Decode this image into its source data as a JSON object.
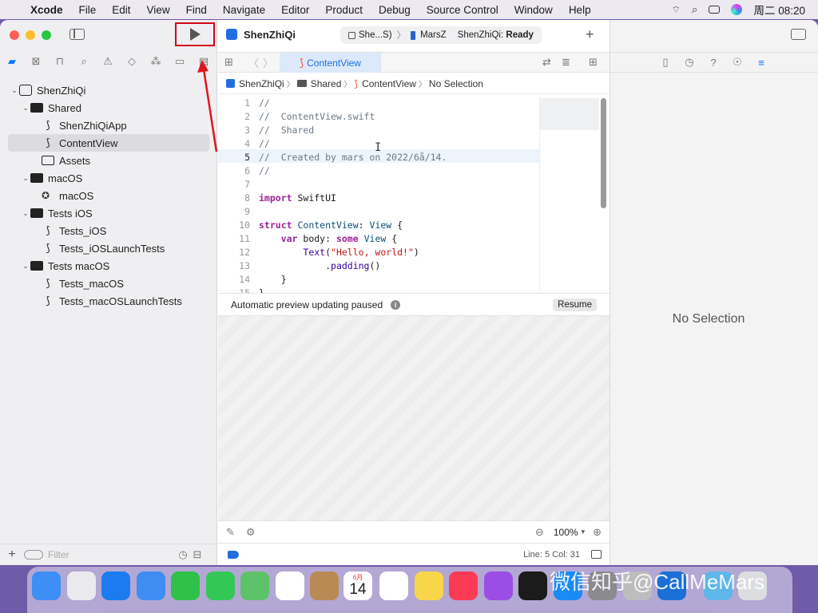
{
  "menubar": {
    "app_name": "Xcode",
    "items": [
      "File",
      "Edit",
      "View",
      "Find",
      "Navigate",
      "Editor",
      "Product",
      "Debug",
      "Source Control",
      "Window",
      "Help"
    ],
    "clock": "周二 08:20"
  },
  "toolbar": {
    "project_title": "ShenZhiQi",
    "scheme": "She...S)",
    "destination": "MarsZ",
    "status_prefix": "ShenZhiQi: ",
    "status_value": "Ready"
  },
  "navigator": {
    "tree": [
      {
        "label": "ShenZhiQi",
        "level": 0,
        "icon": "project-icon",
        "expanded": true
      },
      {
        "label": "Shared",
        "level": 1,
        "icon": "folder-icon",
        "expanded": true
      },
      {
        "label": "ShenZhiQiApp",
        "level": 2,
        "icon": "swift-file-icon"
      },
      {
        "label": "ContentView",
        "level": 2,
        "icon": "swift-file-icon",
        "selected": true
      },
      {
        "label": "Assets",
        "level": 2,
        "icon": "asset-catalog-icon"
      },
      {
        "label": "macOS",
        "level": 1,
        "icon": "folder-icon",
        "expanded": true
      },
      {
        "label": "macOS",
        "level": 2,
        "icon": "entitlements-icon"
      },
      {
        "label": "Tests iOS",
        "level": 1,
        "icon": "folder-icon",
        "expanded": true
      },
      {
        "label": "Tests_iOS",
        "level": 2,
        "icon": "swift-file-icon"
      },
      {
        "label": "Tests_iOSLaunchTests",
        "level": 2,
        "icon": "swift-file-icon"
      },
      {
        "label": "Tests macOS",
        "level": 1,
        "icon": "folder-icon",
        "expanded": true
      },
      {
        "label": "Tests_macOS",
        "level": 2,
        "icon": "swift-file-icon"
      },
      {
        "label": "Tests_macOSLaunchTests",
        "level": 2,
        "icon": "swift-file-icon"
      }
    ],
    "filter_placeholder": "Filter"
  },
  "editor": {
    "tab_label": "ContentView",
    "breadcrumb": [
      "ShenZhiQi",
      "Shared",
      "ContentView",
      "No Selection"
    ],
    "lines": [
      {
        "n": "1",
        "html": "<span class='cmt'>//</span>"
      },
      {
        "n": "2",
        "html": "<span class='cmt'>//  ContentView.swift</span>"
      },
      {
        "n": "3",
        "html": "<span class='cmt'>//  Shared</span>"
      },
      {
        "n": "4",
        "html": "<span class='cmt'>//</span>"
      },
      {
        "n": "5",
        "html": "<span class='cmt'>//  Created by mars on 2022/6å/14.</span>"
      },
      {
        "n": "6",
        "html": "<span class='cmt'>//</span>"
      },
      {
        "n": "7",
        "html": ""
      },
      {
        "n": "8",
        "html": "<span class='kw'>import</span> SwiftUI"
      },
      {
        "n": "9",
        "html": ""
      },
      {
        "n": "10",
        "html": "<span class='kw'>struct</span> <span class='ty'>ContentView</span>: <span class='ty'>View</span> {"
      },
      {
        "n": "11",
        "html": "    <span class='kw'>var</span> body: <span class='kw'>some</span> <span class='ty'>View</span> {"
      },
      {
        "n": "12",
        "html": "        <span class='fn'>Text</span>(<span class='str'>\"Hello, world!\"</span>)"
      },
      {
        "n": "13",
        "html": "            .<span class='fn'>padding</span>()"
      },
      {
        "n": "14",
        "html": "    }"
      },
      {
        "n": "15",
        "html": "}"
      }
    ],
    "preview_status": "Automatic preview updating paused",
    "resume_label": "Resume",
    "zoom": "100%",
    "cursor_position": "Line: 5  Col: 31"
  },
  "inspector": {
    "empty_label": "No Selection"
  },
  "dock": {
    "calendar_month": "6月",
    "calendar_day": "14"
  },
  "watermark": "微信知乎@CallMeMars",
  "colors": {
    "accent": "#0a7aff",
    "run_highlight": "#d0021b",
    "selection_row": "#dcdcdf",
    "current_line": "#eef4fb"
  }
}
